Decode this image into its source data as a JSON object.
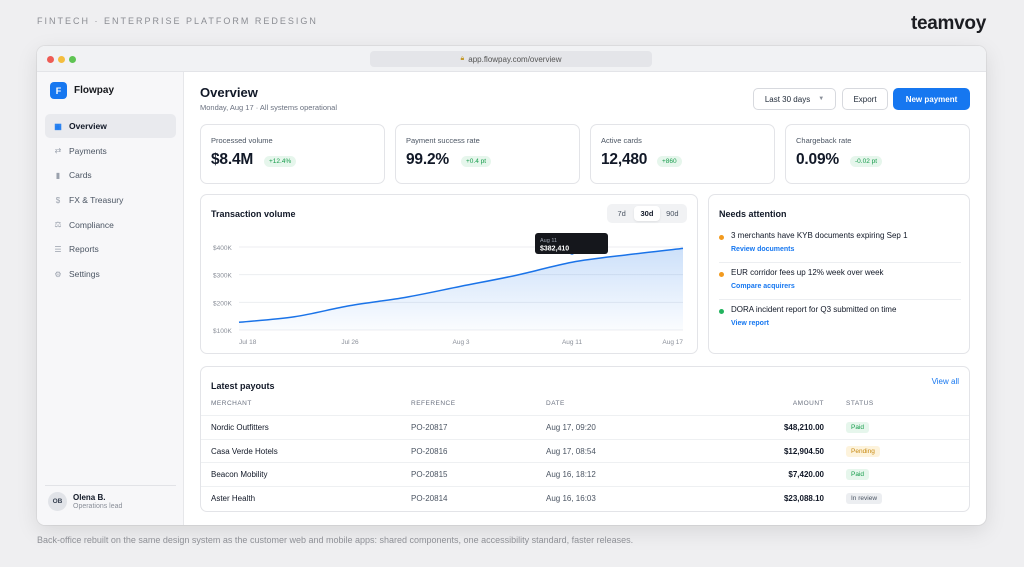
{
  "caption": {
    "top": "FINTECH · ENTERPRISE PLATFORM REDESIGN",
    "brand": "teamvoy",
    "bottom": "Back-office rebuilt on the same design system as the customer web and mobile apps: shared components, one accessibility standard, faster releases."
  },
  "browser": {
    "url": "app.flowpay.com/overview",
    "lock_icon": "lock-icon"
  },
  "sidebar": {
    "logo_letter": "F",
    "app_name": "Flowpay",
    "items": [
      {
        "label": "Overview",
        "icon": "grid-icon",
        "glyph": "▦",
        "active": true
      },
      {
        "label": "Payments",
        "icon": "transfer-icon",
        "glyph": "⇄",
        "active": false
      },
      {
        "label": "Cards",
        "icon": "card-icon",
        "glyph": "▮",
        "active": false
      },
      {
        "label": "FX & Treasury",
        "icon": "dollar-icon",
        "glyph": "$",
        "active": false
      },
      {
        "label": "Compliance",
        "icon": "scale-icon",
        "glyph": "⚖",
        "active": false
      },
      {
        "label": "Reports",
        "icon": "list-icon",
        "glyph": "☰",
        "active": false
      },
      {
        "label": "Settings",
        "icon": "gear-icon",
        "glyph": "⚙",
        "active": false
      }
    ],
    "user": {
      "initials": "OB",
      "name": "Olena B.",
      "role": "Operations lead"
    }
  },
  "header": {
    "title": "Overview",
    "subtitle": "Monday, Aug 17 · All systems operational",
    "range_label": "Last 30 days",
    "export_label": "Export",
    "new_payment_label": "New payment"
  },
  "kpis": [
    {
      "label": "Processed volume",
      "value": "$8.4M",
      "delta": "+12.4%"
    },
    {
      "label": "Payment success rate",
      "value": "99.2%",
      "delta": "+0.4 pt"
    },
    {
      "label": "Active cards",
      "value": "12,480",
      "delta": "+860"
    },
    {
      "label": "Chargeback rate",
      "value": "0.09%",
      "delta": "-0.02 pt"
    }
  ],
  "chart": {
    "title": "Transaction volume",
    "segments": [
      "7d",
      "30d",
      "90d"
    ],
    "active_segment": "30d",
    "tooltip": {
      "date": "Aug 11",
      "value": "$382,410"
    }
  },
  "chart_data": {
    "type": "area",
    "title": "Transaction volume",
    "x_ticks": [
      "Jul 18",
      "Jul 26",
      "Aug 3",
      "Aug 11",
      "Aug 17"
    ],
    "y_ticks": [
      "$400K",
      "$300K",
      "$200K",
      "$100K"
    ],
    "ylim": [
      100000,
      400000
    ],
    "x": [
      "Jul 18",
      "Jul 22",
      "Jul 26",
      "Jul 30",
      "Aug 3",
      "Aug 7",
      "Aug 11",
      "Aug 14",
      "Aug 17"
    ],
    "values": [
      128000,
      148000,
      188000,
      218000,
      258000,
      298000,
      345000,
      372000,
      395000
    ],
    "highlight": {
      "x": "Aug 11",
      "value": 382410
    },
    "grid": true,
    "color": "#1a73e8"
  },
  "attention": {
    "title": "Needs attention",
    "items": [
      {
        "text": "3 merchants have KYB documents expiring Sep 1",
        "link": "Review documents",
        "color": "#f29a1f"
      },
      {
        "text": "EUR corridor fees up 12% week over week",
        "link": "Compare acquirers",
        "color": "#f29a1f"
      },
      {
        "text": "DORA incident report for Q3 submitted on time",
        "link": "View report",
        "color": "#22b35e"
      }
    ]
  },
  "payouts": {
    "title": "Latest payouts",
    "view_all": "View all",
    "columns": [
      "MERCHANT",
      "REFERENCE",
      "DATE",
      "AMOUNT",
      "STATUS"
    ],
    "rows": [
      {
        "merchant": "Nordic Outfitters",
        "reference": "PO-20817",
        "date": "Aug 17, 09:20",
        "amount": "$48,210.00",
        "status": "Paid",
        "kind": "paid"
      },
      {
        "merchant": "Casa Verde Hotels",
        "reference": "PO-20816",
        "date": "Aug 17, 08:54",
        "amount": "$12,904.50",
        "status": "Pending",
        "kind": "pending"
      },
      {
        "merchant": "Beacon Mobility",
        "reference": "PO-20815",
        "date": "Aug 16, 18:12",
        "amount": "$7,420.00",
        "status": "Paid",
        "kind": "paid"
      },
      {
        "merchant": "Aster Health",
        "reference": "PO-20814",
        "date": "Aug 16, 16:03",
        "amount": "$23,088.10",
        "status": "In review",
        "kind": "review"
      }
    ]
  }
}
